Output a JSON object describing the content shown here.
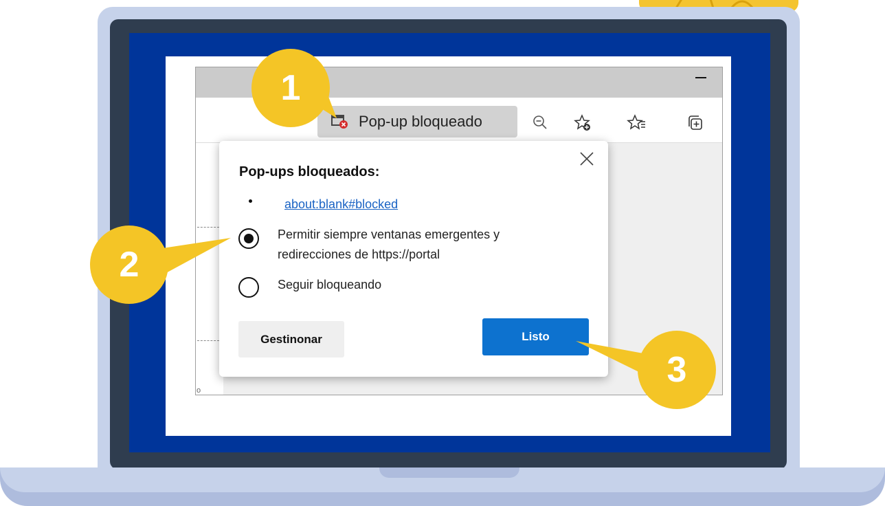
{
  "toolbar": {
    "popup_badge_label": "Pop-up bloqueado"
  },
  "dialog": {
    "title": "Pop-ups bloqueados:",
    "blocked_link": "about:blank#blocked",
    "allow_option_line1": "Permitir siempre ventanas emergentes y",
    "allow_option_line2": "redirecciones de  https://portal",
    "allow_option_selected": true,
    "block_option": "Seguir bloqueando",
    "manage_button": "Gestinonar",
    "done_button": "Listo"
  },
  "callouts": {
    "step1": "1",
    "step2": "2",
    "step3": "3"
  },
  "colors": {
    "screen_blue": "#00359a",
    "callout_yellow": "#f4c526",
    "done_button_blue": "#0d72cf",
    "link_blue": "#1a63c4"
  },
  "icons": {
    "badge": "blocked-window-icon",
    "zoom": "zoom-out-icon",
    "fav_add": "add-favorite-icon",
    "favorites": "favorites-icon",
    "collections": "collections-icon",
    "close": "close-icon"
  }
}
